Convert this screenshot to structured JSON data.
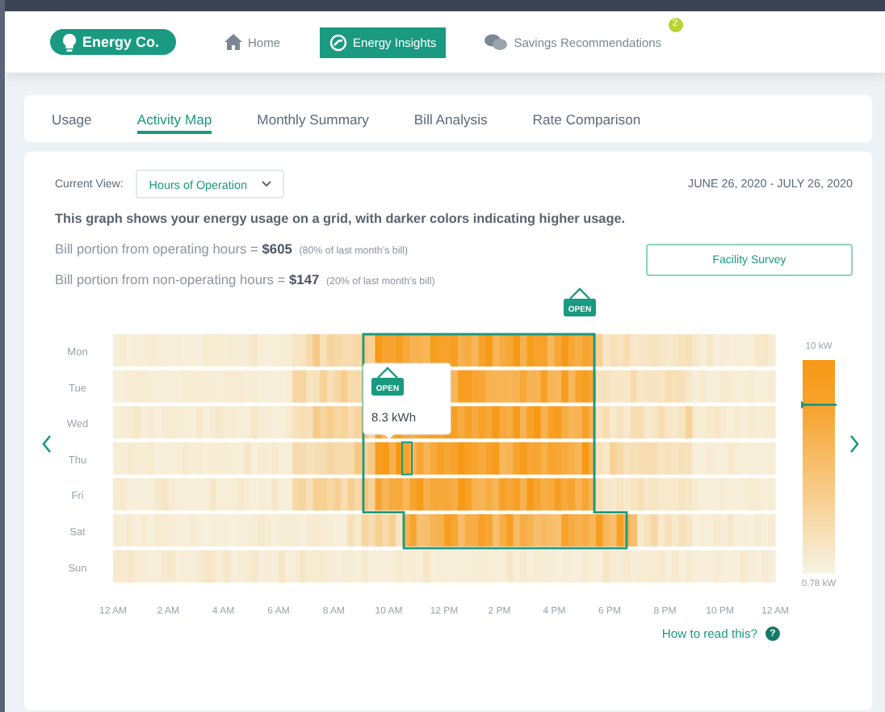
{
  "header": {
    "logo": "Energy Co.",
    "nav": [
      {
        "label": "Home",
        "kind": "home",
        "selected": false
      },
      {
        "label": "Energy Insights",
        "kind": "insights",
        "selected": true
      },
      {
        "label": "Savings Recommendations",
        "kind": "chat",
        "selected": false,
        "badge": "2"
      }
    ]
  },
  "tabs": [
    {
      "label": "Usage",
      "selected": false
    },
    {
      "label": "Activity Map",
      "selected": true
    },
    {
      "label": "Monthly Summary",
      "selected": false
    },
    {
      "label": "Bill Analysis",
      "selected": false
    },
    {
      "label": "Rate Comparison",
      "selected": false
    }
  ],
  "view": {
    "label": "Current View:",
    "value": "Hours of Operation"
  },
  "date_range": "JUNE 26, 2020 - JULY 26, 2020",
  "description": "This graph shows your energy usage on a grid, with darker colors indicating higher usage.",
  "bill_lines": [
    {
      "text": "Bill portion from operating hours = **$605**",
      "note": "(80% of last month’s bill)"
    },
    {
      "text": "Bill portion from non-operating hours = **$147**",
      "note": "(20% of last month’s bill)"
    }
  ],
  "facility_button": "Facility Survey",
  "heatmap": {
    "days": [
      "Mon",
      "Tue",
      "Wed",
      "Thu",
      "Fri",
      "Sat",
      "Sun"
    ],
    "x_labels": [
      "12 AM",
      "2 AM",
      "4 AM",
      "6 AM",
      "8 AM",
      "10 AM",
      "12 PM",
      "2 PM",
      "4 PM",
      "6 PM",
      "8 PM",
      "10 PM",
      "12 AM"
    ],
    "open_sign": "OPEN",
    "tooltip": {
      "sign": "OPEN",
      "value": "8.3 kWh"
    },
    "legend": {
      "max": "10 kW",
      "min": "0.78 kW",
      "level": 0.79
    }
  },
  "help": {
    "label": "How to read this?",
    "icon_text": "?"
  }
}
